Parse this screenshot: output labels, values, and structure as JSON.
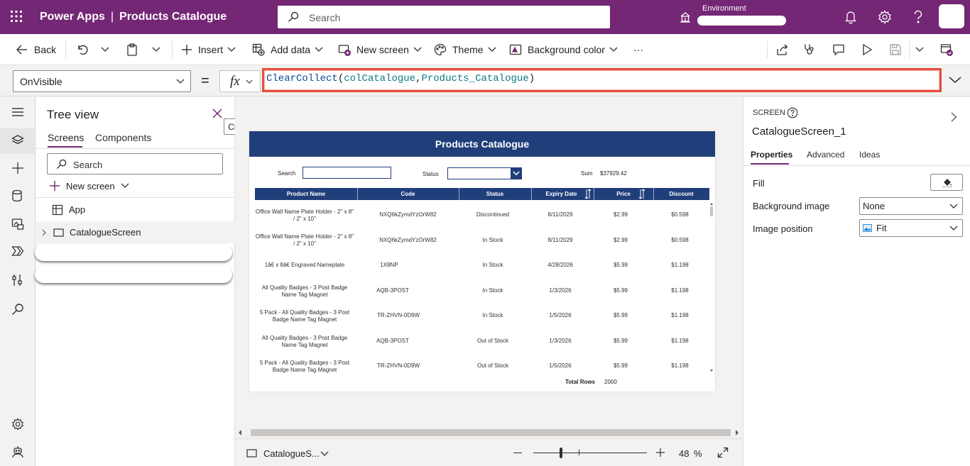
{
  "header": {
    "app_name": "Power Apps",
    "separator": "|",
    "doc_title": "Products Catalogue",
    "search_placeholder": "Search",
    "environment_label": "Environment"
  },
  "commandbar": {
    "back": "Back",
    "insert": "Insert",
    "add_data": "Add data",
    "new_screen": "New screen",
    "theme": "Theme",
    "background_color": "Background color",
    "more": "···"
  },
  "formula": {
    "property": "OnVisible",
    "equals": "=",
    "fx": "fx",
    "fn": "ClearCollect",
    "open": "(",
    "arg1": "colCatalogue",
    "comma": ",",
    "arg2": "Products_Catalogue",
    "close": ")"
  },
  "tree": {
    "title": "Tree view",
    "tab_screens": "Screens",
    "tab_components": "Components",
    "search_placeholder": "Search",
    "new_screen": "New screen",
    "node_app": "App",
    "node_screen": "CatalogueScreen",
    "close_tooltip": "Close"
  },
  "app": {
    "header_title": "Products Catalogue",
    "search_label": "Search",
    "status_label": "Status",
    "sum_label": "Sum",
    "sum_value": "$37929.42",
    "columns": [
      "Product Name",
      "Code",
      "Status",
      "Expiry Date",
      "Price",
      "Discount"
    ],
    "rows": [
      {
        "name": "Office Wall Name Plate Holder - 2\" x 8\" / 2\" x 10\"",
        "code": "NXQ6kZymdYzOrW82",
        "status": "Discontinued",
        "expiry": "8/11/2029",
        "price": "$2.99",
        "discount": "$0.598"
      },
      {
        "name": "Office Wall Name Plate Holder - 2\" x 8\" / 2\" x 10\"",
        "code": "NXQ6kZymdYzOrW82",
        "status": "In Stock",
        "expiry": "8/11/2029",
        "price": "$2.99",
        "discount": "$0.598"
      },
      {
        "name": "1â€ x 8â€ Engraved Nameplate",
        "code": "1X8NP",
        "status": "In Stock",
        "expiry": "4/28/2026",
        "price": "$5.99",
        "discount": "$1.198"
      },
      {
        "name": "All Quality Badges - 3 Post Badge Name Tag Magnet",
        "code": "AQB-3POST",
        "status": "In Stock",
        "expiry": "1/3/2026",
        "price": "$5.99",
        "discount": "$1.198"
      },
      {
        "name": "5 Pack - All Quality Badges - 3 Post Badge Name Tag Magnet",
        "code": "TR-ZHVN-0D9W",
        "status": "In Stock",
        "expiry": "1/5/2026",
        "price": "$5.99",
        "discount": "$1.198"
      },
      {
        "name": "All Quality Badges - 3 Post Badge Name Tag Magnet",
        "code": "AQB-3POST",
        "status": "Out of Stock",
        "expiry": "1/3/2026",
        "price": "$5.99",
        "discount": "$1.198"
      },
      {
        "name": "5 Pack - All Quality Badges - 3 Post Badge Name Tag Magnet",
        "code": "TR-ZHVN-0D9W",
        "status": "Out of Stock",
        "expiry": "1/5/2026",
        "price": "$5.99",
        "discount": "$1.198"
      }
    ],
    "total_label": "Total Rows",
    "total_value": "2000"
  },
  "statusbar": {
    "screen_name": "CatalogueS...",
    "zoom": "48",
    "zoom_unit": "%"
  },
  "props": {
    "kind": "SCREEN",
    "name": "CatalogueScreen_1",
    "tab_properties": "Properties",
    "tab_advanced": "Advanced",
    "tab_ideas": "Ideas",
    "fill_label": "Fill",
    "bg_image_label": "Background image",
    "bg_image_value": "None",
    "img_pos_label": "Image position",
    "img_pos_value": "Fit"
  },
  "colors": {
    "brand": "#742774",
    "app_header": "#203e7a",
    "highlight": "#e74c3c"
  }
}
